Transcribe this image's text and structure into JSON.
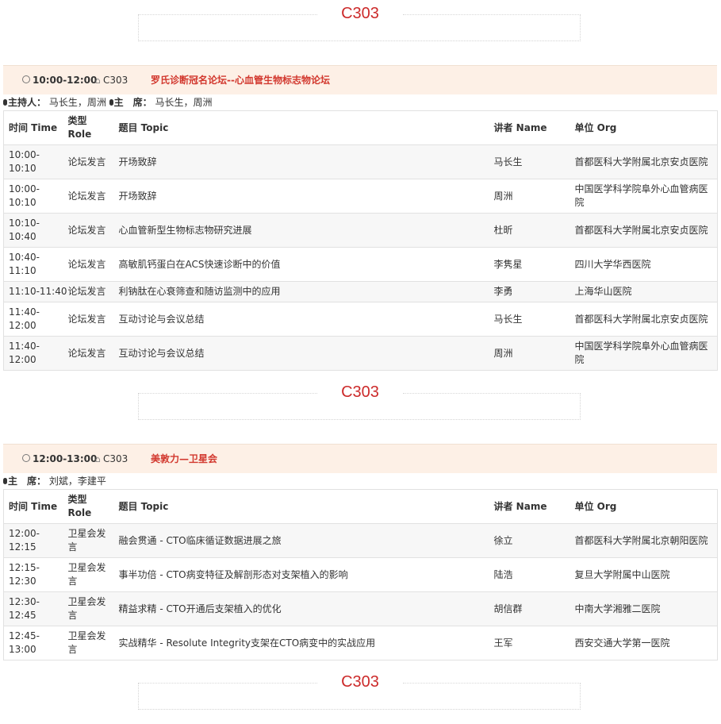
{
  "room_label": "C303",
  "sessions": [
    {
      "time": "10:00-12:00",
      "room": "C303",
      "name": "罗氏诊断冠名论坛--心血管生物标志物论坛",
      "chairs_text": "主持人：  马长生，周洲 ",
      "chairs_text2": "主    席：  马长生，周洲",
      "headers": {
        "time": "时间 Time",
        "role": "类型\nRole",
        "topic": "题目 Topic",
        "speaker": "讲者 Name",
        "org": "单位 Org"
      },
      "rows": [
        {
          "time": "10:00-10:10",
          "role": "论坛发言",
          "topic": "开场致辞",
          "speaker": "马长生",
          "org": "首都医科大学附属北京安贞医院"
        },
        {
          "time": "10:00-10:10",
          "role": "论坛发言",
          "topic": "开场致辞",
          "speaker": "周洲",
          "org": "中国医学科学院阜外心血管病医院"
        },
        {
          "time": "10:10-10:40",
          "role": "论坛发言",
          "topic": "心血管新型生物标志物研究进展",
          "speaker": "杜昕",
          "org": "首都医科大学附属北京安贞医院"
        },
        {
          "time": "10:40-11:10",
          "role": "论坛发言",
          "topic": "高敏肌钙蛋白在ACS快速诊断中的价值",
          "speaker": "李隽星",
          "org": "四川大学华西医院"
        },
        {
          "time": "11:10-11:40",
          "role": "论坛发言",
          "topic": "利钠肽在心衰筛查和随访监测中的应用",
          "speaker": "李勇",
          "org": "上海华山医院"
        },
        {
          "time": "11:40-12:00",
          "role": "论坛发言",
          "topic": "互动讨论与会议总结",
          "speaker": "马长生",
          "org": "首都医科大学附属北京安贞医院"
        },
        {
          "time": "11:40-12:00",
          "role": "论坛发言",
          "topic": "互动讨论与会议总结",
          "speaker": "周洲",
          "org": "中国医学科学院阜外心血管病医院"
        }
      ]
    },
    {
      "time": "12:00-13:00",
      "room": "C303",
      "name": "美敦力—卫星会",
      "chairs_text": "主    席：  刘斌，李建平",
      "headers": {
        "time": "时间 Time",
        "role": "类型\nRole",
        "topic": "题目 Topic",
        "speaker": "讲者 Name",
        "org": "单位 Org"
      },
      "rows": [
        {
          "time": "12:00-12:15",
          "role": "卫星会发言",
          "topic": "融会贯通 - CTO临床循证数据进展之旅",
          "speaker": "徐立",
          "org": "首都医科大学附属北京朝阳医院"
        },
        {
          "time": "12:15-12:30",
          "role": "卫星会发言",
          "topic": "事半功倍 - CTO病变特征及解剖形态对支架植入的影响",
          "speaker": "陆浩",
          "org": "复旦大学附属中山医院"
        },
        {
          "time": "12:30-12:45",
          "role": "卫星会发言",
          "topic": "精益求精 - CTO开通后支架植入的优化",
          "speaker": "胡信群",
          "org": "中南大学湘雅二医院"
        },
        {
          "time": "12:45-13:00",
          "role": "卫星会发言",
          "topic": "实战精华 - Resolute Integrity支架在CTO病变中的实战应用",
          "speaker": "王军",
          "org": "西安交通大学第一医院"
        }
      ]
    }
  ]
}
